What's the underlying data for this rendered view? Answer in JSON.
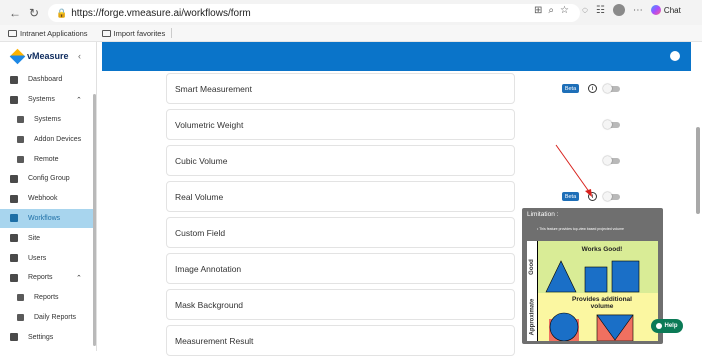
{
  "browser": {
    "url": "https://forge.vmeasure.ai/workflows/form",
    "chat_label": "Chat"
  },
  "favorites": [
    {
      "label": "Intranet Applications"
    },
    {
      "label": "Import favorites"
    }
  ],
  "sidebar": {
    "logo": "vMeasure",
    "items": [
      {
        "label": "Dashboard",
        "icon": "dashboard-icon"
      },
      {
        "label": "Systems",
        "icon": "systems-icon",
        "expanded": true
      },
      {
        "label": "Systems",
        "icon": "systems-sub-icon",
        "sub": true
      },
      {
        "label": "Addon Devices",
        "icon": "devices-icon",
        "sub": true
      },
      {
        "label": "Remote",
        "icon": "remote-icon",
        "sub": true
      },
      {
        "label": "Config Group",
        "icon": "config-icon"
      },
      {
        "label": "Webhook",
        "icon": "webhook-icon"
      },
      {
        "label": "Workflows",
        "icon": "workflows-icon",
        "active": true
      },
      {
        "label": "Site",
        "icon": "site-icon"
      },
      {
        "label": "Users",
        "icon": "users-icon"
      },
      {
        "label": "Reports",
        "icon": "reports-icon",
        "expanded": true
      },
      {
        "label": "Reports",
        "icon": "reports-sub-icon",
        "sub": true
      },
      {
        "label": "Daily Reports",
        "icon": "daily-reports-icon",
        "sub": true
      },
      {
        "label": "Settings",
        "icon": "settings-icon"
      }
    ]
  },
  "form": {
    "rows": [
      {
        "label": "Smart Measurement",
        "beta": "Beta",
        "info": true,
        "toggle": false
      },
      {
        "label": "Volumetric Weight",
        "toggle": false
      },
      {
        "label": "Cubic Volume",
        "toggle": false
      },
      {
        "label": "Real Volume",
        "beta": "Beta",
        "info": true,
        "toggle": false
      },
      {
        "label": "Custom Field"
      },
      {
        "label": "Image Annotation"
      },
      {
        "label": "Mask Background"
      },
      {
        "label": "Measurement Result"
      }
    ]
  },
  "tooltip": {
    "title": "Limitation :",
    "note": "This feature provides top-view based projected volume",
    "good_label": "Good",
    "good_caption": "Works Good!",
    "approx_label": "Approximate",
    "approx_caption": "Provides additional volume"
  },
  "help": {
    "label": "Help"
  },
  "colors": {
    "brand": "#0a74c9",
    "active_nav": "#a8d5ee",
    "beta": "#1e6fb8",
    "help": "#0b7a56"
  }
}
